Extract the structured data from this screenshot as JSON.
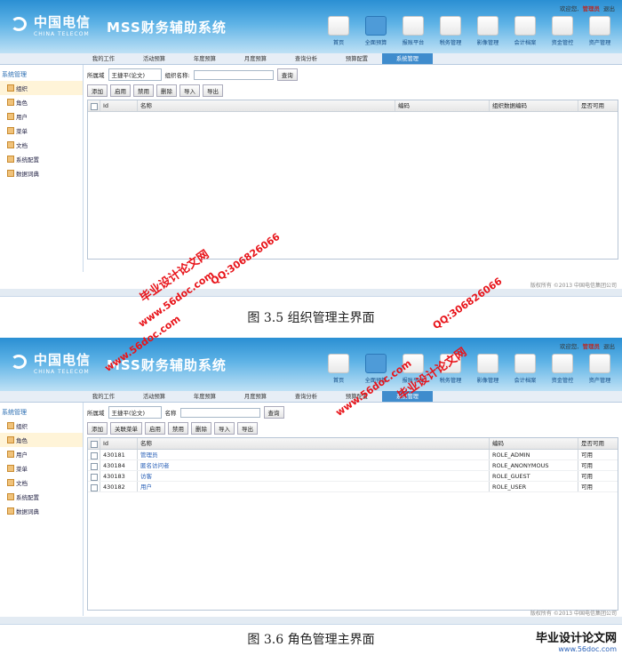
{
  "header": {
    "logo_cn": "中国电信",
    "logo_en": "CHINA TELECOM",
    "app_title": "MSS财务辅助系统",
    "welcome": "欢迎您,",
    "user": "管理员",
    "logout": "退出",
    "nav": [
      "首页",
      "全面预算",
      "报账平台",
      "税务管理",
      "影像管理",
      "会计档案",
      "资金管控",
      "资产管理"
    ]
  },
  "tabs": [
    "我的工作",
    "活动预算",
    "年度预算",
    "月度预算",
    "查询分析",
    "预算配置",
    "系统管理"
  ],
  "active_tab": "系统管理",
  "sidebar": {
    "title": "系统管理",
    "items": [
      "组织",
      "角色",
      "用户",
      "菜单",
      "文档",
      "系统配置",
      "数据词典"
    ]
  },
  "screen1": {
    "active_sidebar": "组织",
    "filter": {
      "domain_label": "所属域",
      "domain_value": "王捷平(论文)",
      "name_label": "组织名称:",
      "query": "查询"
    },
    "toolbar": [
      "添加",
      "启用",
      "禁用",
      "删除",
      "导入",
      "导出"
    ],
    "columns": [
      "Id",
      "名称",
      "编码",
      "组织数据编码",
      "是否可用"
    ],
    "rows": [],
    "footer": "版权所有 ©2013 中国电信集团公司"
  },
  "caption1": "图 3.5 组织管理主界面",
  "screen2": {
    "active_sidebar": "角色",
    "filter": {
      "domain_label": "所属域",
      "domain_value": "王捷平(论文)",
      "name_label": "名称",
      "query": "查询"
    },
    "toolbar": [
      "添加",
      "关联菜单",
      "启用",
      "禁用",
      "删除",
      "导入",
      "导出"
    ],
    "columns": [
      "Id",
      "名称",
      "编码",
      "是否可用"
    ],
    "rows": [
      {
        "id": "430181",
        "name": "管理员",
        "code": "ROLE_ADMIN",
        "enabled": "可用"
      },
      {
        "id": "430184",
        "name": "匿名访问者",
        "code": "ROLE_ANONYMOUS",
        "enabled": "可用"
      },
      {
        "id": "430183",
        "name": "访客",
        "code": "ROLE_GUEST",
        "enabled": "可用"
      },
      {
        "id": "430182",
        "name": "用户",
        "code": "ROLE_USER",
        "enabled": "可用"
      }
    ],
    "footer": "版权所有 ©2013 中国电信集团公司"
  },
  "caption2": "图 3.6 角色管理主界面",
  "watermarks": {
    "site_cn": "毕业设计论文网",
    "url": "www.56doc.com",
    "qq": "QQ:306826066",
    "color": "#e8141a"
  }
}
